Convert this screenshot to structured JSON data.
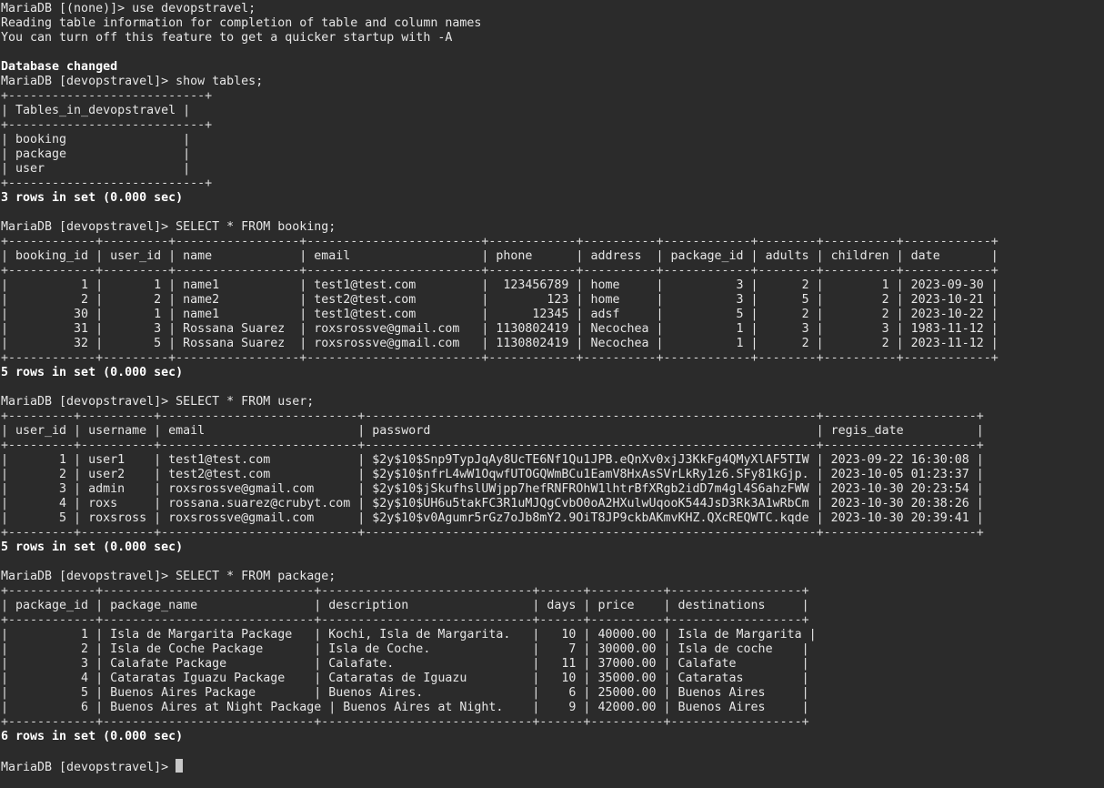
{
  "terminal": {
    "lines": [
      {
        "text": "MariaDB [(none)]> use devopstravel;",
        "kind": "prompt"
      },
      {
        "text": "Reading table information for completion of table and column names",
        "kind": "output"
      },
      {
        "text": "You can turn off this feature to get a quicker startup with -A",
        "kind": "output"
      },
      {
        "text": "",
        "kind": "blank"
      },
      {
        "text": "Database changed",
        "kind": "status"
      },
      {
        "text": "MariaDB [devopstravel]> show tables;",
        "kind": "prompt"
      },
      {
        "text": "+---------------------------+",
        "kind": "border"
      },
      {
        "text": "| Tables_in_devopstravel |",
        "kind": "row"
      },
      {
        "text": "+---------------------------+",
        "kind": "border"
      },
      {
        "text": "| booking                |",
        "kind": "row"
      },
      {
        "text": "| package                |",
        "kind": "row"
      },
      {
        "text": "| user                   |",
        "kind": "row"
      },
      {
        "text": "+---------------------------+",
        "kind": "border"
      },
      {
        "text": "3 rows in set (0.000 sec)",
        "kind": "status"
      },
      {
        "text": "",
        "kind": "blank"
      },
      {
        "text": "MariaDB [devopstravel]> SELECT * FROM booking;",
        "kind": "prompt"
      },
      {
        "text": "+------------+---------+-----------------+------------------------+------------+----------+------------+--------+----------+------------+",
        "kind": "border"
      },
      {
        "text": "| booking_id | user_id | name            | email                  | phone      | address  | package_id | adults | children | date       |",
        "kind": "row"
      },
      {
        "text": "+------------+---------+-----------------+------------------------+------------+----------+------------+--------+----------+------------+",
        "kind": "border"
      },
      {
        "text": "|          1 |       1 | name1           | test1@test.com         |  123456789 | home     |          3 |      2 |        1 | 2023-09-30 |",
        "kind": "row"
      },
      {
        "text": "|          2 |       2 | name2           | test2@test.com         |        123 | home     |          3 |      5 |        2 | 2023-10-21 |",
        "kind": "row"
      },
      {
        "text": "|         30 |       1 | name1           | test1@test.com         |      12345 | adsf     |          5 |      2 |        2 | 2023-10-22 |",
        "kind": "row"
      },
      {
        "text": "|         31 |       3 | Rossana Suarez  | roxsrossve@gmail.com   | 1130802419 | Necochea |          1 |      3 |        3 | 1983-11-12 |",
        "kind": "row"
      },
      {
        "text": "|         32 |       5 | Rossana Suarez  | roxsrossve@gmail.com   | 1130802419 | Necochea |          1 |      2 |        2 | 2023-11-12 |",
        "kind": "row"
      },
      {
        "text": "+------------+---------+-----------------+------------------------+------------+----------+------------+--------+----------+------------+",
        "kind": "border"
      },
      {
        "text": "5 rows in set (0.000 sec)",
        "kind": "status"
      },
      {
        "text": "",
        "kind": "blank"
      },
      {
        "text": "MariaDB [devopstravel]> SELECT * FROM user;",
        "kind": "prompt"
      },
      {
        "text": "+---------+----------+---------------------------+--------------------------------------------------------------+---------------------+",
        "kind": "border"
      },
      {
        "text": "| user_id | username | email                     | password                                                     | regis_date          |",
        "kind": "row"
      },
      {
        "text": "+---------+----------+---------------------------+--------------------------------------------------------------+---------------------+",
        "kind": "border"
      },
      {
        "text": "|       1 | user1    | test1@test.com            | $2y$10$Snp9TypJqAy8UcTE6Nf1Qu1JPB.eQnXv0xjJ3KkFg4QMyXlAF5TIW | 2023-09-22 16:30:08 |",
        "kind": "row"
      },
      {
        "text": "|       2 | user2    | test2@test.com            | $2y$10$nfrL4wW1OqwfUTOGQWmBCu1EamV8HxAsSVrLkRy1z6.SFy81kGjp. | 2023-10-05 01:23:37 |",
        "kind": "row"
      },
      {
        "text": "|       3 | admin    | roxsrossve@gmail.com      | $2y$10$jSkufhslUWjpp7hefRNFROhW1lhtrBfXRgb2idD7m4gl4S6ahzFWW | 2023-10-30 20:23:54 |",
        "kind": "row"
      },
      {
        "text": "|       4 | roxs     | rossana.suarez@crubyt.com | $2y$10$UH6u5takFC3R1uMJQgCvbO0oA2HXulwUqooK544JsD3Rk3A1wRbCm | 2023-10-30 20:38:26 |",
        "kind": "row"
      },
      {
        "text": "|       5 | roxsross | roxsrossve@gmail.com      | $2y$10$v0Agumr5rGz7oJb8mY2.9OiT8JP9ckbAKmvKHZ.QXcREQWTC.kqde | 2023-10-30 20:39:41 |",
        "kind": "row"
      },
      {
        "text": "+---------+----------+---------------------------+--------------------------------------------------------------+---------------------+",
        "kind": "border"
      },
      {
        "text": "5 rows in set (0.000 sec)",
        "kind": "status"
      },
      {
        "text": "",
        "kind": "blank"
      },
      {
        "text": "MariaDB [devopstravel]> SELECT * FROM package;",
        "kind": "prompt"
      },
      {
        "text": "+------------+-----------------------------+-----------------------------+------+----------+------------------+",
        "kind": "border"
      },
      {
        "text": "| package_id | package_name                | description                 | days | price    | destinations     |",
        "kind": "row"
      },
      {
        "text": "+------------+-----------------------------+-----------------------------+------+----------+------------------+",
        "kind": "border"
      },
      {
        "text": "|          1 | Isla de Margarita Package   | Kochi, Isla de Margarita.   |   10 | 40000.00 | Isla de Margarita |",
        "kind": "row"
      },
      {
        "text": "|          2 | Isla de Coche Package       | Isla de Coche.              |    7 | 30000.00 | Isla de coche    |",
        "kind": "row"
      },
      {
        "text": "|          3 | Calafate Package            | Calafate.                   |   11 | 37000.00 | Calafate         |",
        "kind": "row"
      },
      {
        "text": "|          4 | Cataratas Iguazu Package    | Cataratas de Iguazu         |   10 | 35000.00 | Cataratas        |",
        "kind": "row"
      },
      {
        "text": "|          5 | Buenos Aires Package        | Buenos Aires.               |    6 | 25000.00 | Buenos Aires     |",
        "kind": "row"
      },
      {
        "text": "|          6 | Buenos Aires at Night Package | Buenos Aires at Night.    |    9 | 42000.00 | Buenos Aires     |",
        "kind": "row"
      },
      {
        "text": "+------------+-----------------------------+-----------------------------+------+----------+------------------+",
        "kind": "border"
      },
      {
        "text": "6 rows in set (0.000 sec)",
        "kind": "status"
      },
      {
        "text": "",
        "kind": "blank"
      }
    ],
    "prompt": "MariaDB [devopstravel]> ",
    "colors": {
      "background": "#2b2b2b",
      "foreground": "#e6e6e6",
      "cursor": "#c8c8c8"
    }
  }
}
